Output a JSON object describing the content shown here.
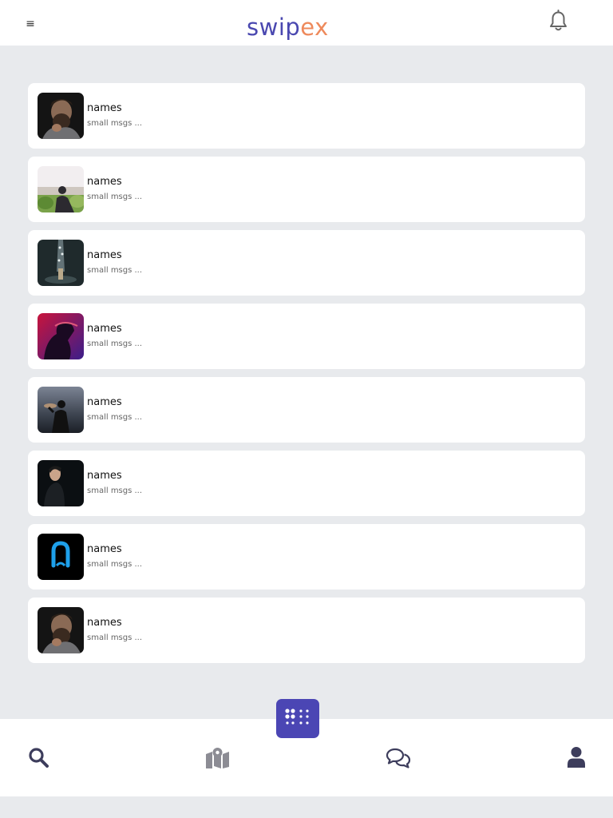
{
  "header": {
    "menu_icon": "≡",
    "logo_part1": "swip",
    "logo_part2": "ex",
    "notification_icon": "bell-icon"
  },
  "colors": {
    "brand_primary": "#4a48b0",
    "brand_secondary": "#ee8a5c",
    "fab_background": "#4b46b4",
    "nav_icon": "#3d3d5c",
    "background": "#e8eaed"
  },
  "conversations": [
    {
      "name": "names",
      "message": "small msgs ..."
    },
    {
      "name": "names",
      "message": "small msgs ..."
    },
    {
      "name": "names",
      "message": "small msgs ..."
    },
    {
      "name": "names",
      "message": "small msgs ..."
    },
    {
      "name": "names",
      "message": "small msgs ..."
    },
    {
      "name": "names",
      "message": "small msgs ..."
    },
    {
      "name": "names",
      "message": "small msgs ..."
    },
    {
      "name": "names",
      "message": "small msgs ..."
    }
  ],
  "bottom_nav": {
    "items": [
      "search-icon",
      "map-icon",
      "chat-icon",
      "user-icon"
    ],
    "center_button": "apps-grid-icon"
  }
}
